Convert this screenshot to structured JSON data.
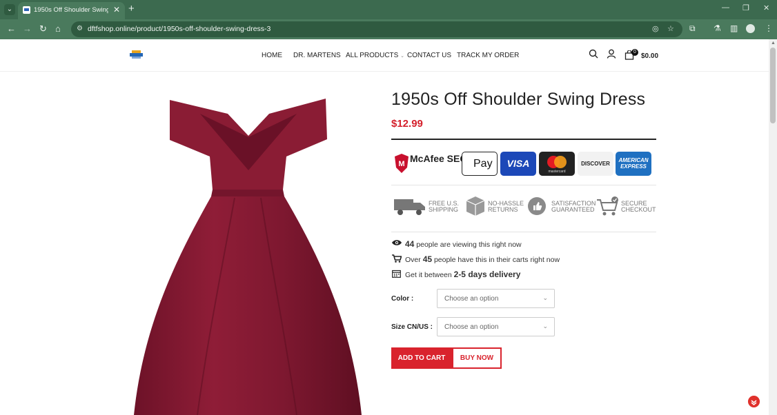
{
  "browser": {
    "tab_title": "1950s Off Shoulder Swing Dress",
    "url": "dftfshop.online/product/1950s-off-shoulder-swing-dress-3"
  },
  "header": {
    "nav": [
      "HOME",
      "DR. MARTENS",
      "ALL PRODUCTS",
      "CONTACT US",
      "TRACK MY ORDER"
    ],
    "cart_count": "0",
    "cart_total": "$0.00"
  },
  "product": {
    "title": "1950s Off Shoulder Swing Dress",
    "price": "$12.99",
    "dress_color": "#8a1c34"
  },
  "badges": {
    "mcafee": "McAfee SECURE",
    "applepay": "Pay",
    "visa": "VISA",
    "mastercard": "mastercard",
    "discover": "DISCOVER",
    "amex": "AMERICAN EXPRESS"
  },
  "features": [
    {
      "icon": "truck-icon",
      "label_1": "FREE U.S.",
      "label_2": "SHIPPING"
    },
    {
      "icon": "box-icon",
      "label_1": "NO-HASSLE",
      "label_2": "RETURNS"
    },
    {
      "icon": "thumbs-up-icon",
      "label_1": "SATISFACTION",
      "label_2": "GUARANTEED"
    },
    {
      "icon": "cart-check-icon",
      "label_1": "SECURE",
      "label_2": "CHECKOUT"
    }
  ],
  "info": {
    "viewing_count": "44",
    "viewing_text": "people are viewing this right now",
    "carts_prefix": "Over",
    "carts_count": "45",
    "carts_text": "people have this in their carts right now",
    "delivery_prefix": "Get it between",
    "delivery_bold": "2-5 days delivery"
  },
  "options": {
    "color_label": "Color :",
    "color_value": "Choose an option",
    "size_label": "Size CN/US :",
    "size_value": "Choose an option"
  },
  "buttons": {
    "add_to_cart": "ADD TO CART",
    "buy_now": "BUY NOW"
  }
}
